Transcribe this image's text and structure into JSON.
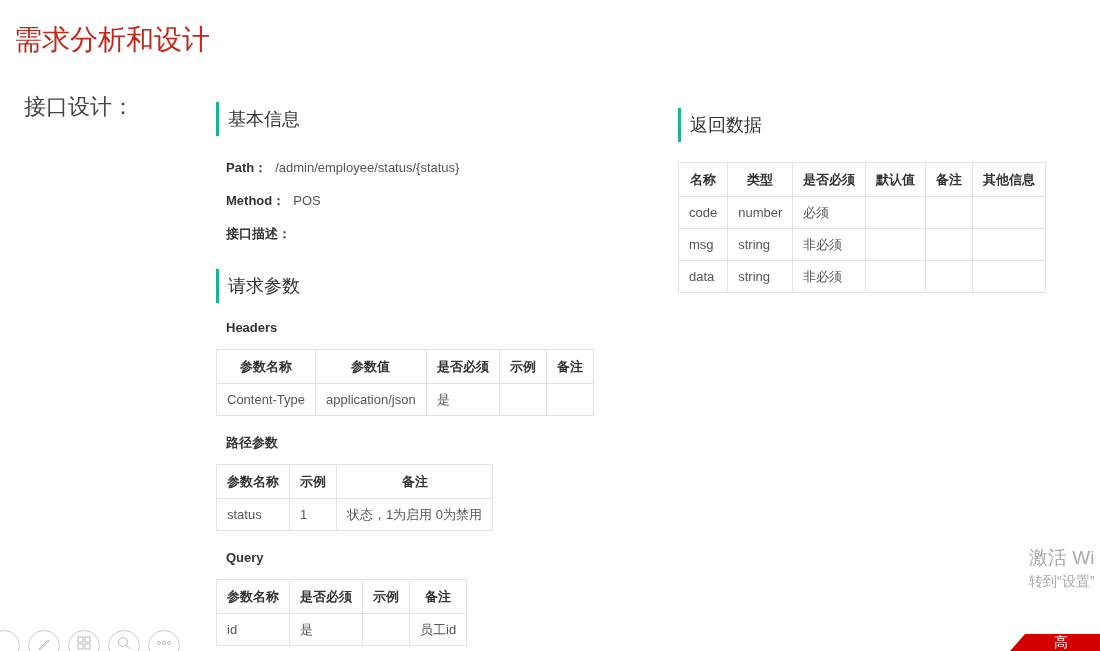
{
  "title": "需求分析和设计",
  "subtitle": "接口设计：",
  "basic_info": {
    "heading": "基本信息",
    "fields": [
      {
        "label": "Path：",
        "value": "/admin/employee/status/{status}"
      },
      {
        "label": "Method：",
        "value": "POS"
      },
      {
        "label": "接口描述："
      }
    ]
  },
  "request_params": {
    "heading": "请求参数",
    "sections": [
      {
        "label": "Headers",
        "columns": [
          "参数名称",
          "参数值",
          "是否必须",
          "示例",
          "备注"
        ],
        "rows": [
          [
            "Content-Type",
            "application/json",
            "是",
            "",
            ""
          ]
        ]
      },
      {
        "label": "路径参数",
        "columns": [
          "参数名称",
          "示例",
          "备注"
        ],
        "rows": [
          [
            "status",
            "1",
            "状态，1为启用 0为禁用"
          ]
        ]
      },
      {
        "label": "Query",
        "columns": [
          "参数名称",
          "是否必须",
          "示例",
          "备注"
        ],
        "rows": [
          [
            "id",
            "是",
            "",
            "员工id"
          ]
        ]
      }
    ]
  },
  "response": {
    "heading": "返回数据",
    "columns": [
      "名称",
      "类型",
      "是否必须",
      "默认值",
      "备注",
      "其他信息"
    ],
    "rows": [
      [
        "code",
        "number",
        "必须",
        "",
        "",
        ""
      ],
      [
        "msg",
        "string",
        "非必须",
        "",
        "",
        ""
      ],
      [
        "data",
        "string",
        "非必须",
        "",
        "",
        ""
      ]
    ]
  },
  "activation_notice": {
    "title": "激活 Wi",
    "subtitle": "转到“设置”"
  },
  "corner_badge": "高"
}
